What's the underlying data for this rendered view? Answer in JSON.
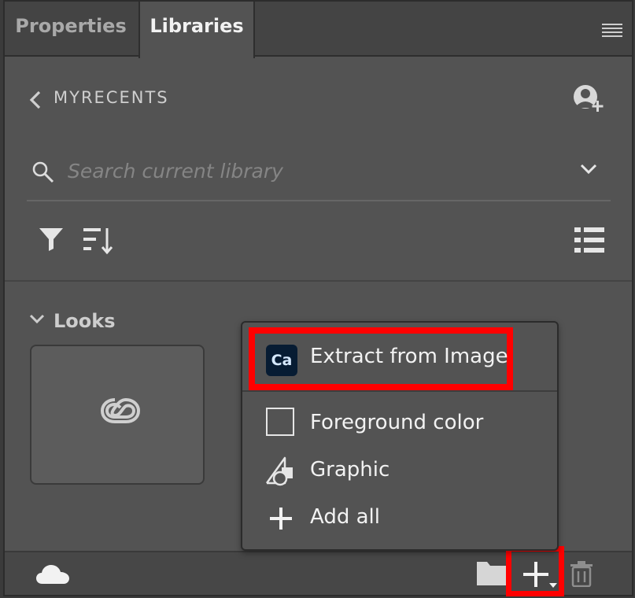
{
  "tabs": [
    {
      "label": "Properties"
    },
    {
      "label": "Libraries"
    }
  ],
  "library": {
    "name": "MYRECENTS"
  },
  "search": {
    "placeholder": "Search current library"
  },
  "groups": [
    {
      "title": "Looks"
    }
  ],
  "menu": {
    "items": [
      {
        "badge": "Ca",
        "label": "Extract from Image",
        "icon": "capture-app-icon"
      },
      {
        "label": "Foreground color",
        "icon": "color-swatch-icon"
      },
      {
        "label": "Graphic",
        "icon": "graphic-icon"
      },
      {
        "label": "Add all",
        "icon": "plus-icon"
      }
    ]
  },
  "colors": {
    "panel": "#535353",
    "tabbar": "#444444",
    "highlight": "#ff0000",
    "ca_badge": "#071c33"
  }
}
